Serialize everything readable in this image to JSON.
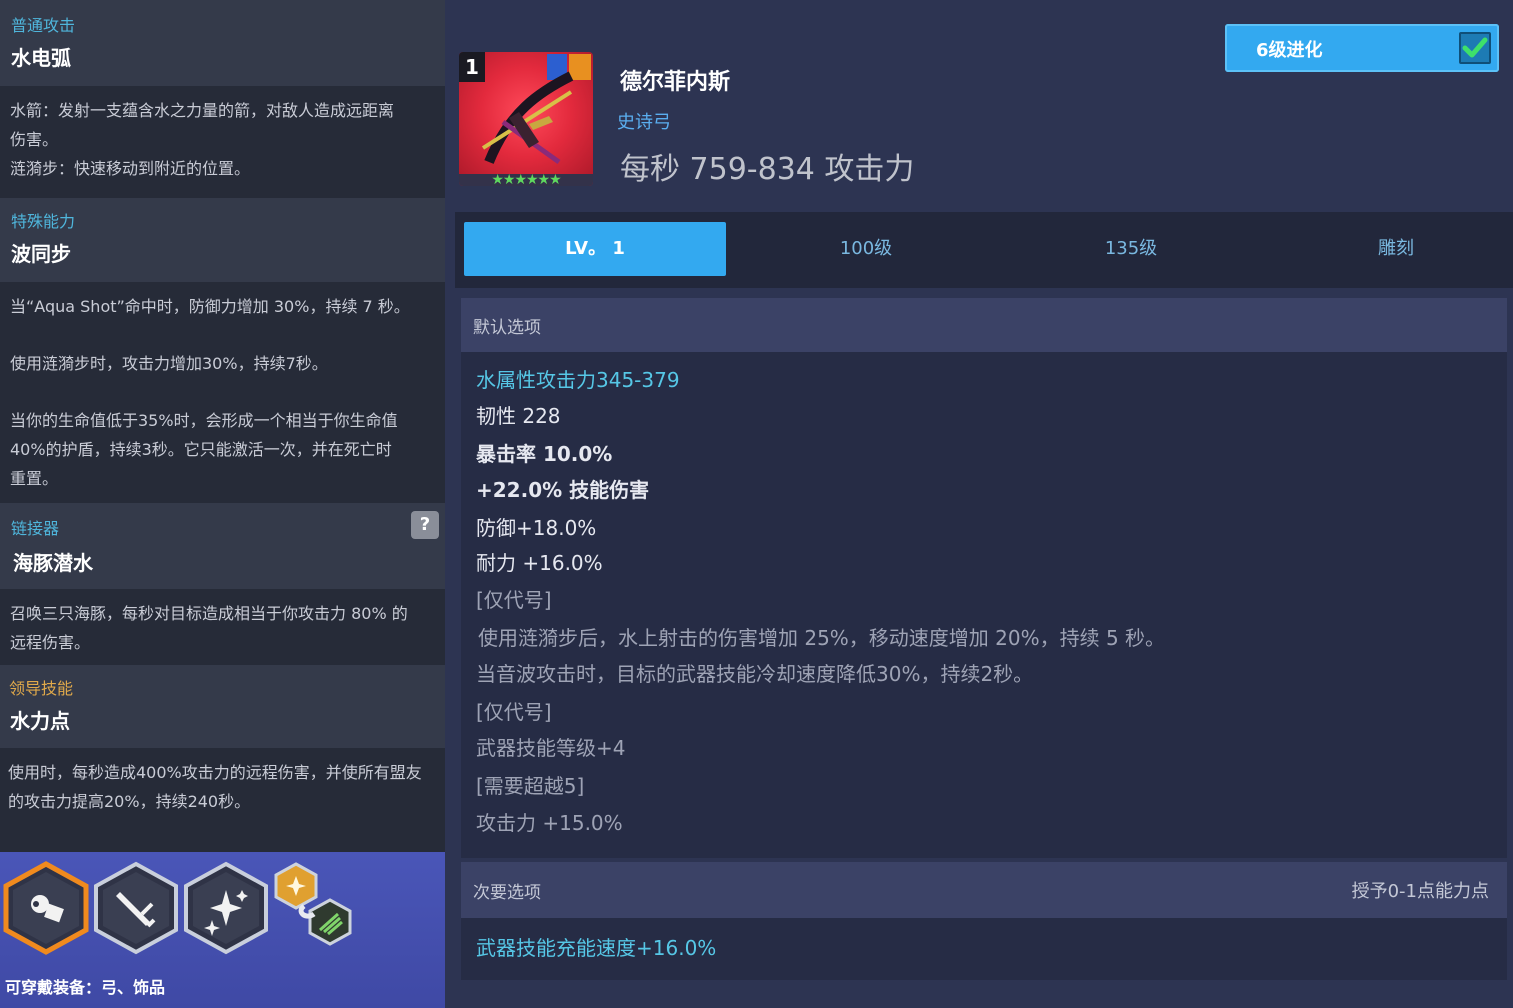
{
  "left": {
    "basic_attack": {
      "label": "普通攻击",
      "title": "水电弧",
      "desc_1": "水箭：发射一支蕴含水之力量的箭，对敌人造成远距离",
      "desc_2": "伤害。",
      "desc_3": "涟漪步：快速移动到附近的位置。"
    },
    "special": {
      "label": "特殊能力",
      "title": "波同步",
      "desc_1": "当“Aqua Shot”命中时，防御力增加 30%，持续 7 秒。",
      "desc_2": "使用涟漪步时，攻击力增加30%，持续7秒。",
      "desc_3": "当你的生命值低于35%时，会形成一个相当于你生命值",
      "desc_4": "40%的护盾，持续3秒。它只能激活一次，并在死亡时",
      "desc_5": "重置。"
    },
    "chain": {
      "label": "链接器",
      "help": "?",
      "title": "海豚潜水",
      "desc_1": "召唤三只海豚，每秒对目标造成相当于你攻击力 80% 的",
      "desc_2": "远程伤害。"
    },
    "leader": {
      "label": "领导技能",
      "title": "水力点",
      "desc_1": "使用时，每秒造成400%攻击力的远程伤害，并使所有盟友",
      "desc_2": "的攻击力提高20%，持续240秒。"
    },
    "equip_label": "可穿戴装备：弓、饰品"
  },
  "weapon": {
    "slot_number": "1",
    "name": "德尔菲内斯",
    "rarity": "史诗弓",
    "dps": "每秒 759-834 攻击力",
    "stars": "★★★★★★"
  },
  "evolve": {
    "label": "6级进化",
    "checked": true
  },
  "tabs": [
    {
      "label": "LV。 1",
      "active": true
    },
    {
      "label": "100级",
      "active": false
    },
    {
      "label": "135级",
      "active": false
    },
    {
      "label": "雕刻",
      "active": false
    }
  ],
  "main_options": {
    "header": "默认选项",
    "lines": [
      "水属性攻击力345-379",
      "韧性 228",
      "暴击率 10.0%",
      "+22.0% 技能伤害",
      "防御+18.0%",
      "耐力 +16.0%",
      "[仅代号]",
      "使用涟漪步后，水上射击的伤害增加 25%，移动速度增加 20%，持续 5 秒。",
      "当音波攻击时，目标的武器技能冷却速度降低30%，持续2秒。",
      "[仅代号]",
      "武器技能等级+4",
      "[需要超越5]",
      "攻击力 +15.0%"
    ]
  },
  "sub_options": {
    "header": "次要选项",
    "right_note": "授予0-1点能力点",
    "line": "武器技能充能速度+16.0%"
  },
  "colors": {
    "accent_blue": "#33a9f0",
    "cyan_text": "#56c7e6",
    "gold_label": "#e0a94a",
    "weapon_bg_red": "#e32a3d"
  }
}
